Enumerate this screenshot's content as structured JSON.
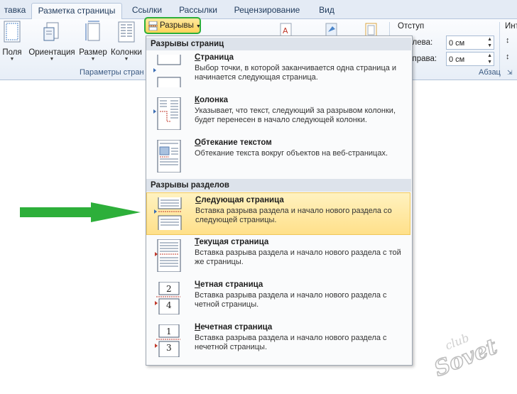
{
  "tabs": [
    {
      "label": "тавка",
      "active": false
    },
    {
      "label": "Разметка страницы",
      "active": true
    },
    {
      "label": "Ссылки",
      "active": false
    },
    {
      "label": "Рассылки",
      "active": false
    },
    {
      "label": "Рецензирование",
      "active": false
    },
    {
      "label": "Вид",
      "active": false
    }
  ],
  "ribbon": {
    "buttons": {
      "margins": "Поля",
      "orientation": "Ориентация",
      "size": "Размер",
      "columns": "Колонки"
    },
    "breaks_label": "Разрывы",
    "page_setup_group": "Параметры стран",
    "indent": {
      "heading": "Отступ",
      "left_label": "Слева:",
      "left_value": "0 см",
      "right_label": "Справа:",
      "right_value": "0 см"
    },
    "interval_partial": "Инт",
    "paragraph_group": "Абзац"
  },
  "menu": {
    "page_breaks_header": "Разрывы страниц",
    "section_breaks_header": "Разрывы разделов",
    "page_items": [
      {
        "title_u": "С",
        "title_rest": "траница",
        "desc": "Выбор точки, в которой заканчивается одна страница и начинается следующая страница."
      },
      {
        "title_u": "К",
        "title_rest": "олонка",
        "desc": "Указывает, что текст, следующий за разрывом колонки, будет перенесен в начало следующей колонки."
      },
      {
        "title_u": "О",
        "title_rest": "бтекание текстом",
        "desc": "Обтекание текста вокруг объектов на веб-страницах."
      }
    ],
    "section_items": [
      {
        "title_u": "С",
        "title_rest": "ледующая страница",
        "desc": "Вставка разрыва раздела и начало нового раздела со следующей страницы.",
        "highlighted": true
      },
      {
        "title_u": "Т",
        "title_rest": "екущая страница",
        "desc": "Вставка разрыва раздела и начало нового раздела с той же страницы.",
        "highlighted": false
      },
      {
        "title_u": "Ч",
        "title_rest": "етная страница",
        "desc": "Вставка разрыва раздела и начало нового раздела с четной страницы.",
        "highlighted": false
      },
      {
        "title_u": "Н",
        "title_rest": "ечетная страница",
        "desc": "Вставка разрыва раздела и начало нового раздела с нечетной страницы.",
        "highlighted": false
      }
    ],
    "even_thumb_nums": [
      "2",
      "4"
    ],
    "odd_thumb_nums": [
      "1",
      "3"
    ]
  },
  "watermark": {
    "line1": "club",
    "line2": "Sovet"
  },
  "colors": {
    "accent_green": "#2daf3a",
    "highlight": "#ffe08a",
    "tab_text": "#1e395b"
  }
}
